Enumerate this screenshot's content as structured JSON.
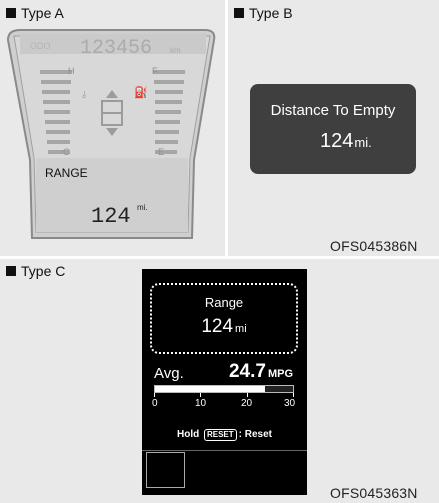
{
  "type_a": {
    "label": "Type A",
    "odometer": "123456",
    "odometer_unit": "km",
    "high_mark": "H",
    "low_mark": "C",
    "fuel_full_mark": "F",
    "fuel_empty_mark": "E",
    "range_label": "RANGE",
    "range_value": "124",
    "range_unit": "mi."
  },
  "type_b": {
    "label": "Type B",
    "title": "Distance To Empty",
    "value": "124",
    "unit": "mi.",
    "code": "OFS045386N"
  },
  "type_c": {
    "label": "Type C",
    "range_label": "Range",
    "range_value": "124",
    "range_unit": "mi",
    "avg_label": "Avg.",
    "avg_value": "24.7",
    "avg_unit": "MPG",
    "bar_fraction": 0.8,
    "scale_ticks": [
      "0",
      "10",
      "20",
      "30"
    ],
    "hold_text": "Hold",
    "reset_key": "RESET",
    "reset_text": ": Reset",
    "code": "OFS045363N"
  }
}
